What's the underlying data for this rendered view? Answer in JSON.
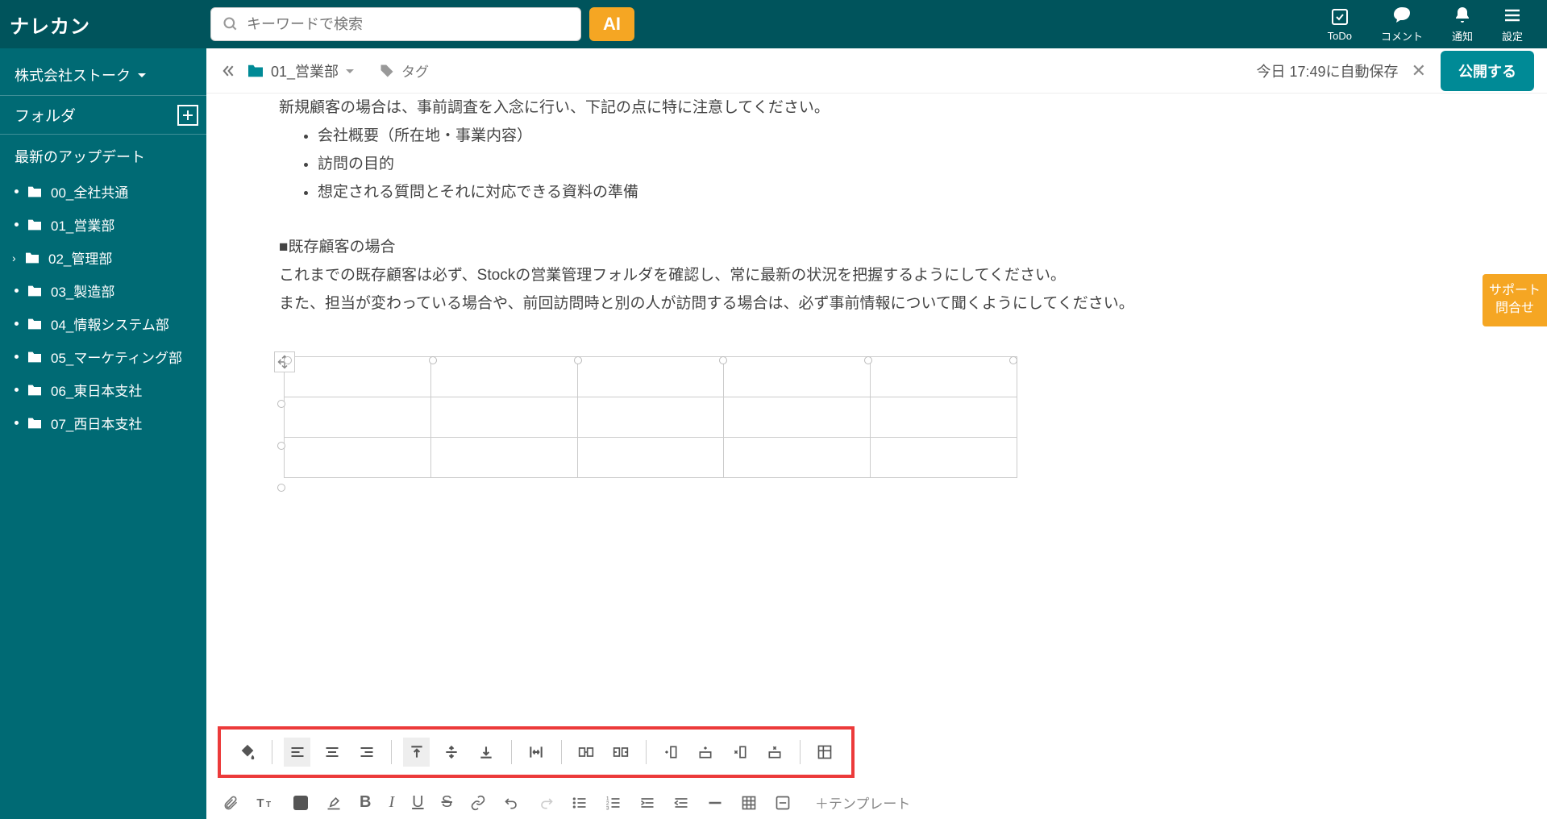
{
  "app": {
    "name": "ナレカン"
  },
  "search": {
    "placeholder": "キーワードで検索"
  },
  "ai": {
    "label": "AI"
  },
  "header": {
    "todo": "ToDo",
    "comment": "コメント",
    "notify": "通知",
    "settings": "設定"
  },
  "workspace": {
    "name": "株式会社ストーク"
  },
  "sidebar": {
    "folder_header": "フォルダ",
    "updates": "最新のアップデート",
    "folders": [
      {
        "name": "00_全社共通",
        "hasChildren": false
      },
      {
        "name": "01_営業部",
        "hasChildren": false
      },
      {
        "name": "02_管理部",
        "hasChildren": true
      },
      {
        "name": "03_製造部",
        "hasChildren": false
      },
      {
        "name": "04_情報システム部",
        "hasChildren": false
      },
      {
        "name": "05_マーケティング部",
        "hasChildren": false
      },
      {
        "name": "06_東日本支社",
        "hasChildren": false
      },
      {
        "name": "07_西日本支社",
        "hasChildren": false
      }
    ]
  },
  "breadcrumb": {
    "folder": "01_営業部",
    "tag_label": "タグ"
  },
  "editor": {
    "save_status": "今日 17:49に自動保存",
    "publish": "公開する"
  },
  "document": {
    "intro": "新規顧客の場合は、事前調査を入念に行い、下記の点に特に注意してください。",
    "bullets": [
      "会社概要（所在地・事業内容）",
      "訪問の目的",
      "想定される質問とそれに対応できる資料の準備"
    ],
    "section2_title": "■既存顧客の場合",
    "section2_text1": "これまでの既存顧客は必ず、Stockの営業管理フォルダを確認し、常に最新の状況を把握するようにしてください。",
    "section2_text2": "また、担当が変わっている場合や、前回訪問時と別の人が訪問する場合は、必ず事前情報について聞くようにしてください。"
  },
  "table_toolbar": {
    "items": [
      "fill-color",
      "align-left",
      "align-center",
      "align-right",
      "valign-top",
      "valign-middle",
      "valign-bottom",
      "distribute-h",
      "merge-cells",
      "split-cells",
      "insert-col",
      "insert-row",
      "delete-col",
      "delete-row",
      "table-properties"
    ]
  },
  "fmt_toolbar": {
    "template": "＋テンプレート"
  },
  "support": {
    "line1": "サポート",
    "line2": "問合せ"
  }
}
